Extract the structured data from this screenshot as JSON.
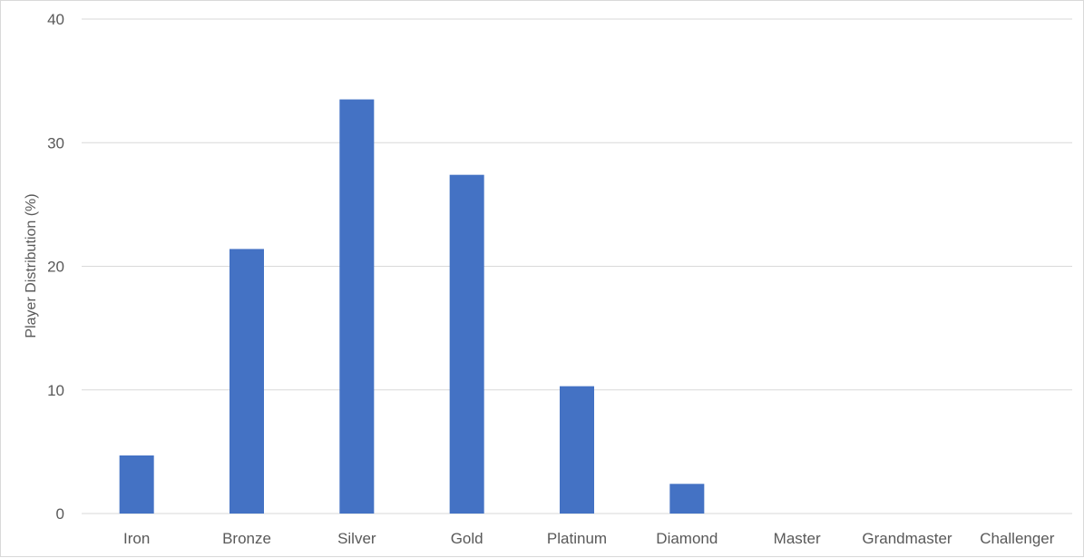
{
  "chart_data": {
    "type": "bar",
    "title": "",
    "xlabel": "",
    "ylabel": "Player Distribution (%)",
    "categories": [
      "Iron",
      "Bronze",
      "Silver",
      "Gold",
      "Platinum",
      "Diamond",
      "Master",
      "Grandmaster",
      "Challenger"
    ],
    "values": [
      4.7,
      21.4,
      33.5,
      27.4,
      10.3,
      2.4,
      0.0,
      0.0,
      0.0
    ],
    "ylim": [
      0,
      40
    ],
    "yticks": [
      "0",
      "10",
      "20",
      "30",
      "40"
    ],
    "grid": true,
    "legend": "none",
    "bar_color": "#4472C4",
    "grid_color": "#d9d9d9"
  }
}
